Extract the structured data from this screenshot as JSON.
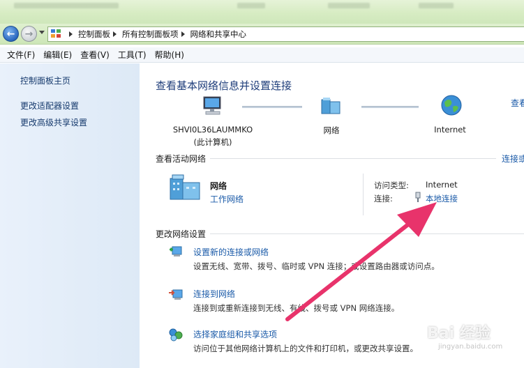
{
  "window": {
    "breadcrumbs": [
      "控制面板",
      "所有控制面板项",
      "网络和共享中心"
    ]
  },
  "menu": [
    "文件(F)",
    "编辑(E)",
    "查看(V)",
    "工具(T)",
    "帮助(H)"
  ],
  "sidebar": {
    "items": [
      {
        "label": "控制面板主页"
      },
      {
        "label": "更改适配器设置"
      },
      {
        "label": "更改高级共享设置"
      }
    ]
  },
  "main": {
    "heading": "查看基本网络信息并设置连接",
    "see_full_map": "查看",
    "map": {
      "computer_name": "SHVI0L36LAUMMKO",
      "computer_sub": "(此计算机)",
      "network": "网络",
      "internet": "Internet"
    },
    "active": {
      "title": "查看活动网络",
      "connect_link": "连接或",
      "network_name": "网络",
      "network_type": "工作网络",
      "access_label": "访问类型:",
      "access_value": "Internet",
      "conn_label": "连接:",
      "conn_value": "本地连接"
    },
    "settings": {
      "title": "更改网络设置",
      "tasks": [
        {
          "label": "设置新的连接或网络",
          "desc": "设置无线、宽带、拨号、临时或 VPN 连接；或设置路由器或访问点。"
        },
        {
          "label": "连接到网络",
          "desc": "连接到或重新连接到无线、有线、拨号或 VPN 网络连接。"
        },
        {
          "label": "选择家庭组和共享选项",
          "desc": "访问位于其他网络计算机上的文件和打印机，或更改共享设置。"
        }
      ]
    }
  },
  "annotation": {
    "arrow_color": "#e8336b"
  },
  "watermark": {
    "text": "Bai 经验",
    "sub": "jingyan.baidu.com"
  }
}
